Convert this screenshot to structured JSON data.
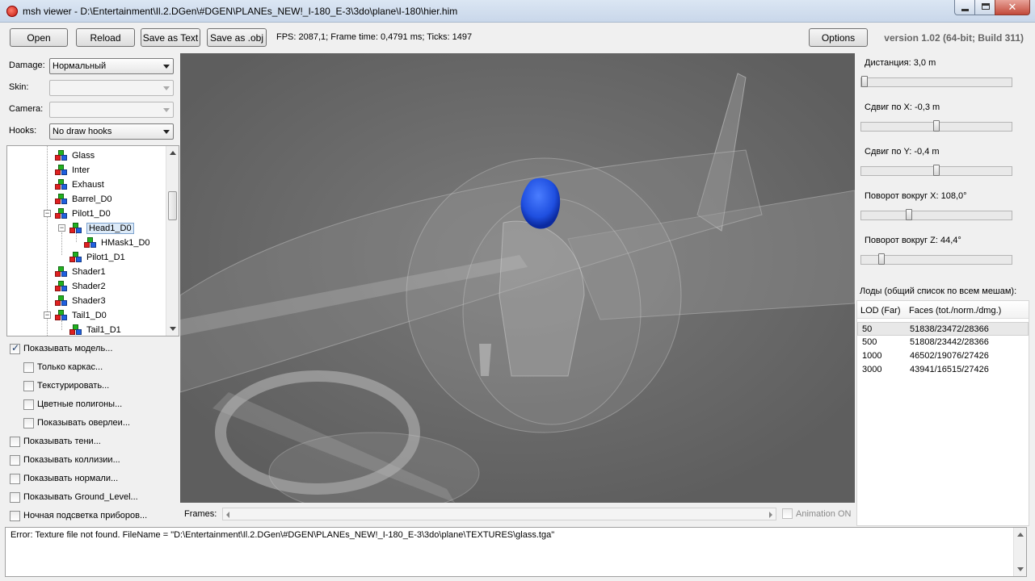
{
  "window": {
    "title": "msh viewer - D:\\Entertainment\\Il.2.DGen\\#DGEN\\PLANEs_NEW!_I-180_E-3\\3do\\plane\\I-180\\hier.him",
    "minimize_glyph": "",
    "maximize_glyph": "",
    "close_glyph": "✕"
  },
  "toolbar": {
    "open": "Open",
    "reload": "Reload",
    "save_text": "Save as Text",
    "save_obj": "Save as .obj",
    "stats": "FPS: 2087,1; Frame time: 0,4791 ms; Ticks: 1497",
    "options": "Options",
    "version": "version 1.02 (64-bit; Build 311)"
  },
  "left": {
    "damage_label": "Damage:",
    "damage_value": "Нормальный",
    "skin_label": "Skin:",
    "skin_value": "",
    "camera_label": "Camera:",
    "camera_value": "",
    "hooks_label": "Hooks:",
    "hooks_value": "No draw hooks",
    "tree": [
      {
        "label": "Glass"
      },
      {
        "label": "Inter"
      },
      {
        "label": "Exhaust"
      },
      {
        "label": "Barrel_D0"
      },
      {
        "label": "Pilot1_D0"
      },
      {
        "label": "Head1_D0"
      },
      {
        "label": "HMask1_D0"
      },
      {
        "label": "Pilot1_D1"
      },
      {
        "label": "Shader1"
      },
      {
        "label": "Shader2"
      },
      {
        "label": "Shader3"
      },
      {
        "label": "Tail1_D0"
      },
      {
        "label": "Tail1_D1"
      }
    ],
    "checks": [
      {
        "label": "Показывать модель...",
        "checked": true
      },
      {
        "label": "Только каркас...",
        "checked": false
      },
      {
        "label": "Текстурировать...",
        "checked": false
      },
      {
        "label": "Цветные полигоны...",
        "checked": false
      },
      {
        "label": "Показывать оверлеи...",
        "checked": false
      },
      {
        "label": "Показывать тени...",
        "checked": false
      },
      {
        "label": "Показывать коллизии...",
        "checked": false
      },
      {
        "label": "Показывать нормали...",
        "checked": false
      },
      {
        "label": "Показывать Ground_Level...",
        "checked": false
      },
      {
        "label": "Ночная подсветка приборов...",
        "checked": false
      }
    ]
  },
  "viewport": {
    "frames_label": "Frames:",
    "animation_label": "Animation ON",
    "background": "#636363",
    "selected_mesh_color": "#1f4fe0"
  },
  "right": {
    "sliders": [
      {
        "label": "Дистанция:  3,0 m",
        "value_fraction": 0.0
      },
      {
        "label": "Сдвиг по X:  -0,3 m",
        "value_fraction": 0.5
      },
      {
        "label": "Сдвиг по Y:  -0,4 m",
        "value_fraction": 0.5
      },
      {
        "label": "Поворот вокруг X:  108,0°",
        "value_fraction": 0.31
      },
      {
        "label": "Поворот вокруг Z:  44,4°",
        "value_fraction": 0.12
      }
    ],
    "lods_label": "Лоды (общий список по всем мешам):",
    "lods_header": {
      "col1": "LOD (Far)",
      "col2": "Faces (tot./norm./dmg.)"
    },
    "lods": [
      {
        "lod": "50",
        "faces": "51838/23472/28366"
      },
      {
        "lod": "500",
        "faces": "51808/23442/28366"
      },
      {
        "lod": "1000",
        "faces": "46502/19076/27426"
      },
      {
        "lod": "3000",
        "faces": "43941/16515/27426"
      }
    ]
  },
  "log": {
    "text": "Error: Texture file not found. FileName = \"D:\\Entertainment\\Il.2.DGen\\#DGEN\\PLANEs_NEW!_I-180_E-3\\3do\\plane\\TEXTURES\\glass.tga\""
  }
}
